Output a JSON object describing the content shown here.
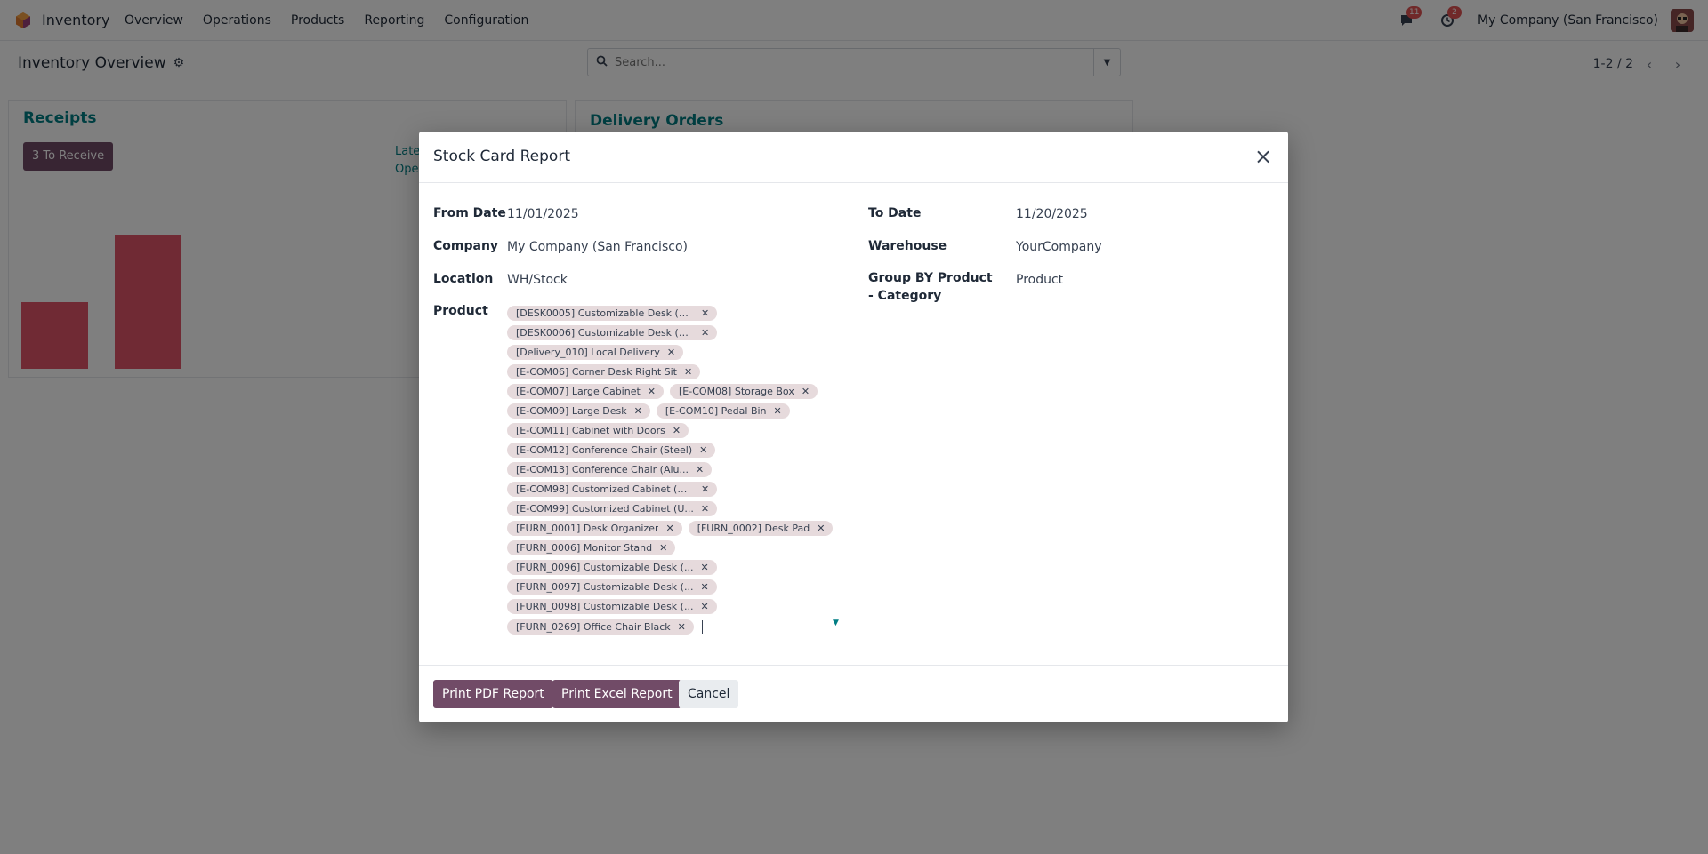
{
  "app": {
    "name": "Inventory",
    "menu": [
      "Overview",
      "Operations",
      "Products",
      "Reporting",
      "Configuration"
    ],
    "chat_badge": "11",
    "activity_badge": "2",
    "company": "My Company (San Francisco)"
  },
  "control": {
    "title": "Inventory Overview",
    "search_placeholder": "Search...",
    "pager": "1-2 / 2"
  },
  "receipts": {
    "title": "Receipts",
    "button": "3 To Receive",
    "link_late": "Late",
    "link_open": "Open",
    "bar_values": [
      1,
      2
    ]
  },
  "delivery": {
    "title": "Delivery Orders"
  },
  "modal": {
    "title": "Stock Card Report",
    "fields": {
      "from_date_label": "From Date",
      "from_date": "11/01/2025",
      "to_date_label": "To Date",
      "to_date": "11/20/2025",
      "company_label": "Company",
      "company": "My Company (San Francisco)",
      "warehouse_label": "Warehouse",
      "warehouse": "YourCompany",
      "location_label": "Location",
      "location": "WH/Stock",
      "group_label": "Group BY Product - Category",
      "group": "Product",
      "product_label": "Product"
    },
    "product_rows": [
      [
        "[DESK0005] Customizable Desk (C..."
      ],
      [
        "[DESK0006] Customizable Desk (C..."
      ],
      [
        "[Delivery_010] Local Delivery"
      ],
      [
        "[E-COM06] Corner Desk Right Sit"
      ],
      [
        "[E-COM07] Large Cabinet",
        "[E-COM08] Storage Box"
      ],
      [
        "[E-COM09] Large Desk",
        "[E-COM10] Pedal Bin"
      ],
      [
        "[E-COM11] Cabinet with Doors"
      ],
      [
        "[E-COM12] Conference Chair (Steel)"
      ],
      [
        "[E-COM13] Conference Chair (Alu..."
      ],
      [
        "[E-COM98] Customized Cabinet (M..."
      ],
      [
        "[E-COM99] Customized Cabinet (U..."
      ],
      [
        "[FURN_0001] Desk Organizer",
        "[FURN_0002] Desk Pad"
      ],
      [
        "[FURN_0006] Monitor Stand"
      ],
      [
        "[FURN_0096] Customizable Desk (..."
      ],
      [
        "[FURN_0097] Customizable Desk (..."
      ],
      [
        "[FURN_0098] Customizable Desk (..."
      ],
      [
        "[FURN_0269] Office Chair Black"
      ]
    ],
    "buttons": {
      "pdf": "Print PDF Report",
      "excel": "Print Excel Report",
      "cancel": "Cancel"
    }
  }
}
